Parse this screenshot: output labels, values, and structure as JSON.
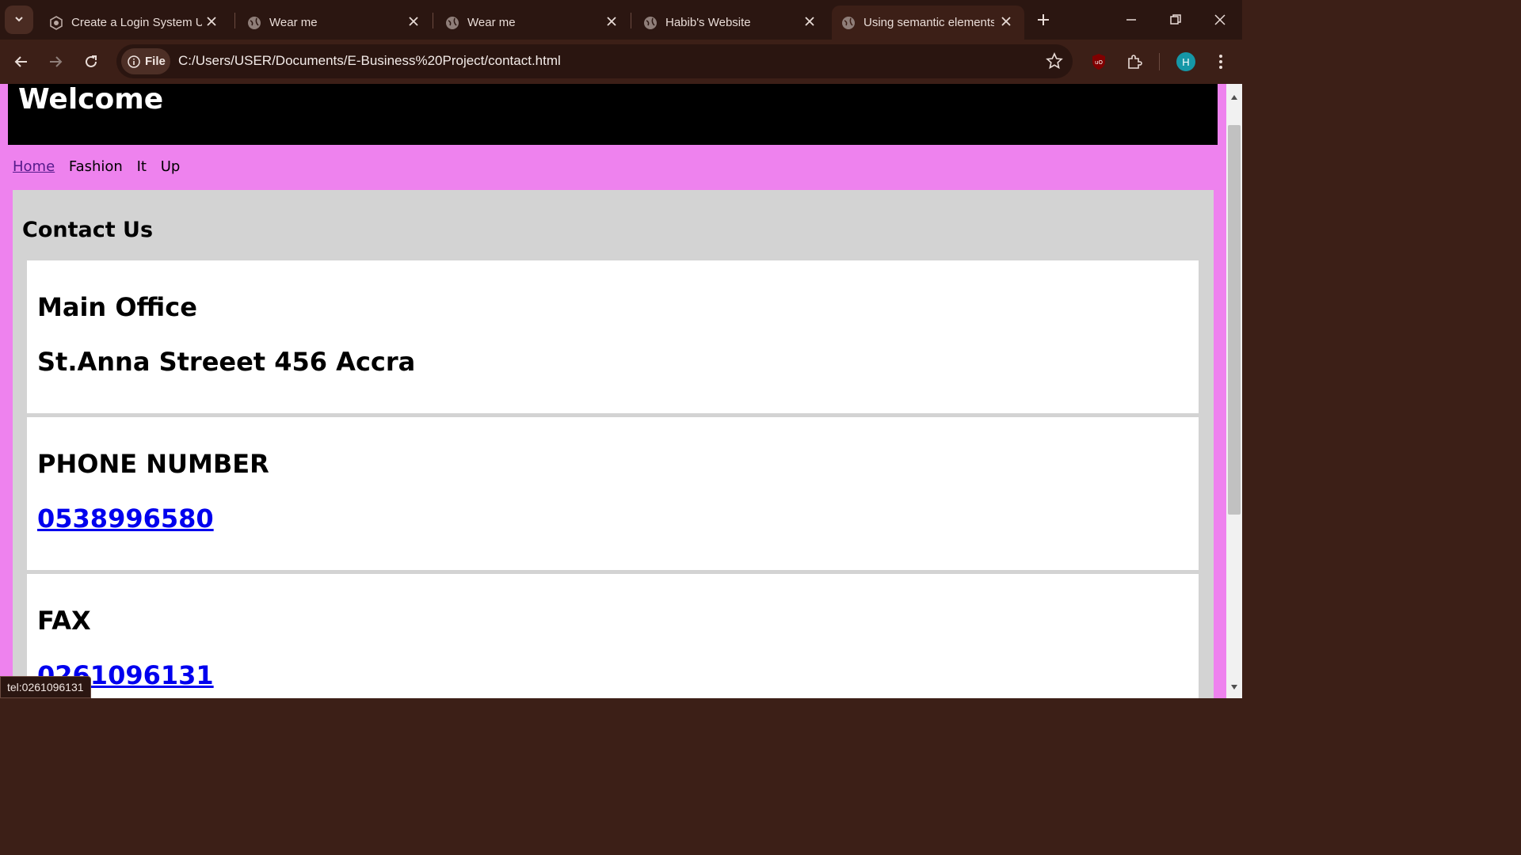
{
  "browser": {
    "tabs": [
      {
        "title": "Create a Login System Us",
        "active": false
      },
      {
        "title": "Wear me",
        "active": false
      },
      {
        "title": "Wear me",
        "active": false
      },
      {
        "title": "Habib's Website",
        "active": false
      },
      {
        "title": "Using semantic elements",
        "active": true
      }
    ],
    "site_chip": "File",
    "url": "C:/Users/USER/Documents/E-Business%20Project/contact.html",
    "profile_initial": "H",
    "status_url": "tel:0261096131",
    "colors": {
      "frame": "#2b1611",
      "toolbar": "#3c1f17",
      "avatar": "#1597a7"
    }
  },
  "page": {
    "header_title": "Welcome",
    "nav": [
      "Home",
      "Fashion",
      "It",
      "Up"
    ],
    "section_title": "Contact Us",
    "cards": [
      {
        "title": "Main Office",
        "value": "St.Anna Streeet 456 Accra",
        "is_link": false
      },
      {
        "title": "PHONE NUMBER",
        "value": "0538996580",
        "is_link": true
      },
      {
        "title": "FAX",
        "value": "0261096131",
        "is_link": true
      }
    ],
    "colors": {
      "background": "#ee82ee",
      "header": "#000000",
      "panel": "#d3d3d3",
      "link": "#0000ee",
      "visited": "#551a8b"
    }
  }
}
